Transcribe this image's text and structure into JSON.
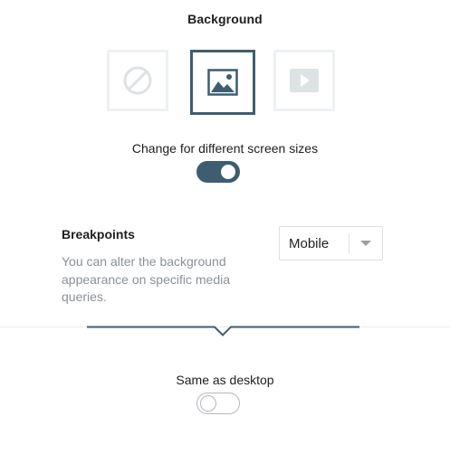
{
  "background": {
    "title": "Background",
    "types": [
      {
        "id": "none",
        "icon": "none-circle-slash-icon",
        "active": false
      },
      {
        "id": "image",
        "icon": "image-icon",
        "active": true
      },
      {
        "id": "video",
        "icon": "video-play-icon",
        "active": false
      }
    ]
  },
  "responsive": {
    "label": "Change for different screen sizes",
    "enabled": true
  },
  "breakpoints": {
    "title": "Breakpoints",
    "description": "You can alter the background appearance on specific media queries.",
    "selected": "Mobile"
  },
  "same_as_desktop": {
    "label": "Same as desktop",
    "enabled": false
  },
  "colors": {
    "accent": "#3e5d71",
    "muted_text": "#8a9198",
    "inactive_border": "#eef1f3",
    "inactive_icon": "#dde2e5"
  }
}
